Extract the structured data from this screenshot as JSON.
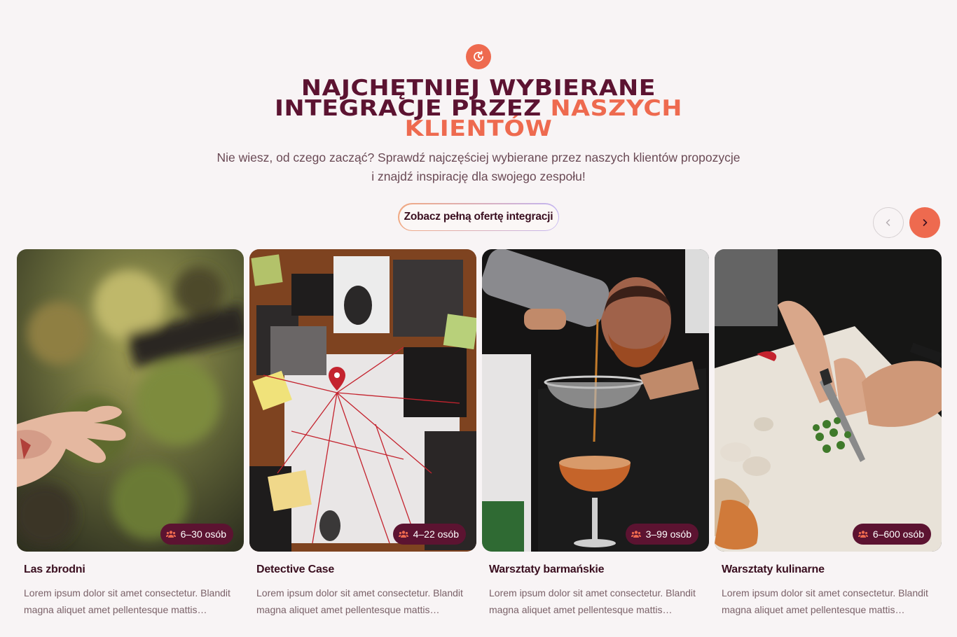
{
  "header": {
    "icon": "clock-refresh-icon",
    "heading_line1": "NAJCHĘTNIEJ WYBIERANE",
    "heading_line2_dark": "INTEGRACJE PRZEZ ",
    "heading_line2_accent": "NASZYCH",
    "heading_line3_accent": "KLIENTÓW",
    "subtitle_line1": "Nie wiesz, od czego zacząć? Sprawdź najczęściej wybierane przez naszych klientów propozycje",
    "subtitle_line2": "i znajdź inspirację dla swojego zespołu!",
    "cta_label": "Zobacz pełną ofertę integracji"
  },
  "carousel": {
    "prev_icon": "chevron-left-icon",
    "next_icon": "chevron-right-icon",
    "cards": [
      {
        "title": "Las zbrodni",
        "people": "6–30 osób",
        "description": "Lorem ipsum dolor sit amet consectetur. Blandit magna aliquet amet pellentesque mattis condimentum."
      },
      {
        "title": "Detective Case",
        "people": "4–22 osób",
        "description": "Lorem ipsum dolor sit amet consectetur. Blandit magna aliquet amet pellentesque mattis condimentum."
      },
      {
        "title": "Warsztaty barmańskie",
        "people": "3–99 osób",
        "description": "Lorem ipsum dolor sit amet consectetur. Blandit magna aliquet amet pellentesque mattis condimentum."
      },
      {
        "title": "Warsztaty kulinarne",
        "people": "6–600 osób",
        "description": "Lorem ipsum dolor sit amet consectetur. Blandit magna aliquet amet pellentesque mattis condimentum."
      }
    ]
  },
  "colors": {
    "accent": "#ee6a4f",
    "brand_dark": "#5c1331",
    "background": "#f8f4f5"
  }
}
